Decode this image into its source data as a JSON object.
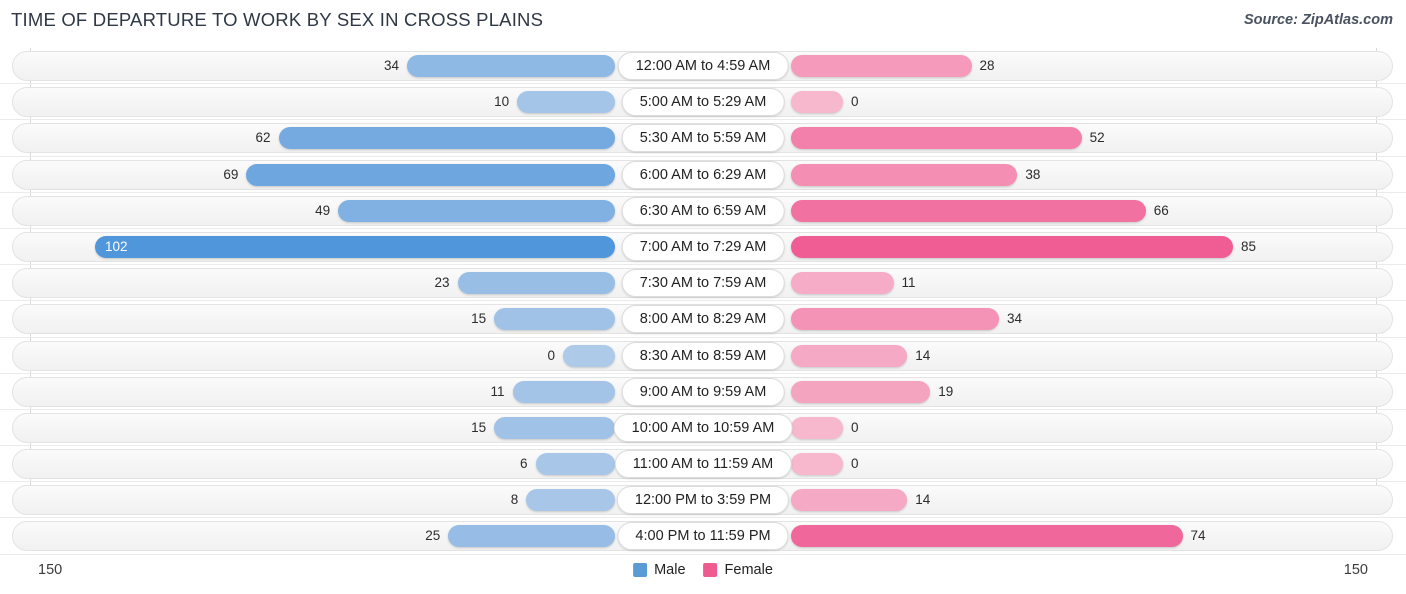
{
  "header": {
    "title": "TIME OF DEPARTURE TO WORK BY SEX IN CROSS PLAINS",
    "source": "Source: ZipAtlas.com"
  },
  "legend": {
    "male_label": "Male",
    "female_label": "Female",
    "male_color": "#5b9bd5",
    "female_color": "#ef5b90"
  },
  "axis": {
    "left_label": "150",
    "right_label": "150",
    "max": 150
  },
  "chart_data": {
    "type": "bar",
    "orientation": "horizontal-diverging",
    "title": "TIME OF DEPARTURE TO WORK BY SEX IN CROSS PLAINS",
    "xlabel": "",
    "ylabel": "",
    "xlim": [
      150,
      150
    ],
    "grid": true,
    "legend_position": "bottom-center",
    "categories": [
      "12:00 AM to 4:59 AM",
      "5:00 AM to 5:29 AM",
      "5:30 AM to 5:59 AM",
      "6:00 AM to 6:29 AM",
      "6:30 AM to 6:59 AM",
      "7:00 AM to 7:29 AM",
      "7:30 AM to 7:59 AM",
      "8:00 AM to 8:29 AM",
      "8:30 AM to 8:59 AM",
      "9:00 AM to 9:59 AM",
      "10:00 AM to 10:59 AM",
      "11:00 AM to 11:59 AM",
      "12:00 PM to 3:59 PM",
      "4:00 PM to 11:59 PM"
    ],
    "series": [
      {
        "name": "Male",
        "values": [
          34,
          10,
          62,
          69,
          49,
          102,
          23,
          15,
          0,
          11,
          15,
          6,
          8,
          25
        ]
      },
      {
        "name": "Female",
        "values": [
          28,
          0,
          52,
          38,
          66,
          85,
          11,
          34,
          14,
          19,
          0,
          0,
          14,
          74
        ]
      }
    ]
  },
  "rows": [
    {
      "label": "12:00 AM to 4:59 AM",
      "male": "34",
      "female": "28"
    },
    {
      "label": "5:00 AM to 5:29 AM",
      "male": "10",
      "female": "0"
    },
    {
      "label": "5:30 AM to 5:59 AM",
      "male": "62",
      "female": "52"
    },
    {
      "label": "6:00 AM to 6:29 AM",
      "male": "69",
      "female": "38"
    },
    {
      "label": "6:30 AM to 6:59 AM",
      "male": "49",
      "female": "66"
    },
    {
      "label": "7:00 AM to 7:29 AM",
      "male": "102",
      "female": "85"
    },
    {
      "label": "7:30 AM to 7:59 AM",
      "male": "23",
      "female": "11"
    },
    {
      "label": "8:00 AM to 8:29 AM",
      "male": "15",
      "female": "34"
    },
    {
      "label": "8:30 AM to 8:59 AM",
      "male": "0",
      "female": "14"
    },
    {
      "label": "9:00 AM to 9:59 AM",
      "male": "11",
      "female": "19"
    },
    {
      "label": "10:00 AM to 10:59 AM",
      "male": "15",
      "female": "0"
    },
    {
      "label": "11:00 AM to 11:59 AM",
      "male": "6",
      "female": "0"
    },
    {
      "label": "12:00 PM to 3:59 PM",
      "male": "8",
      "female": "14"
    },
    {
      "label": "4:00 PM to 11:59 PM",
      "male": "25",
      "female": "74"
    }
  ]
}
